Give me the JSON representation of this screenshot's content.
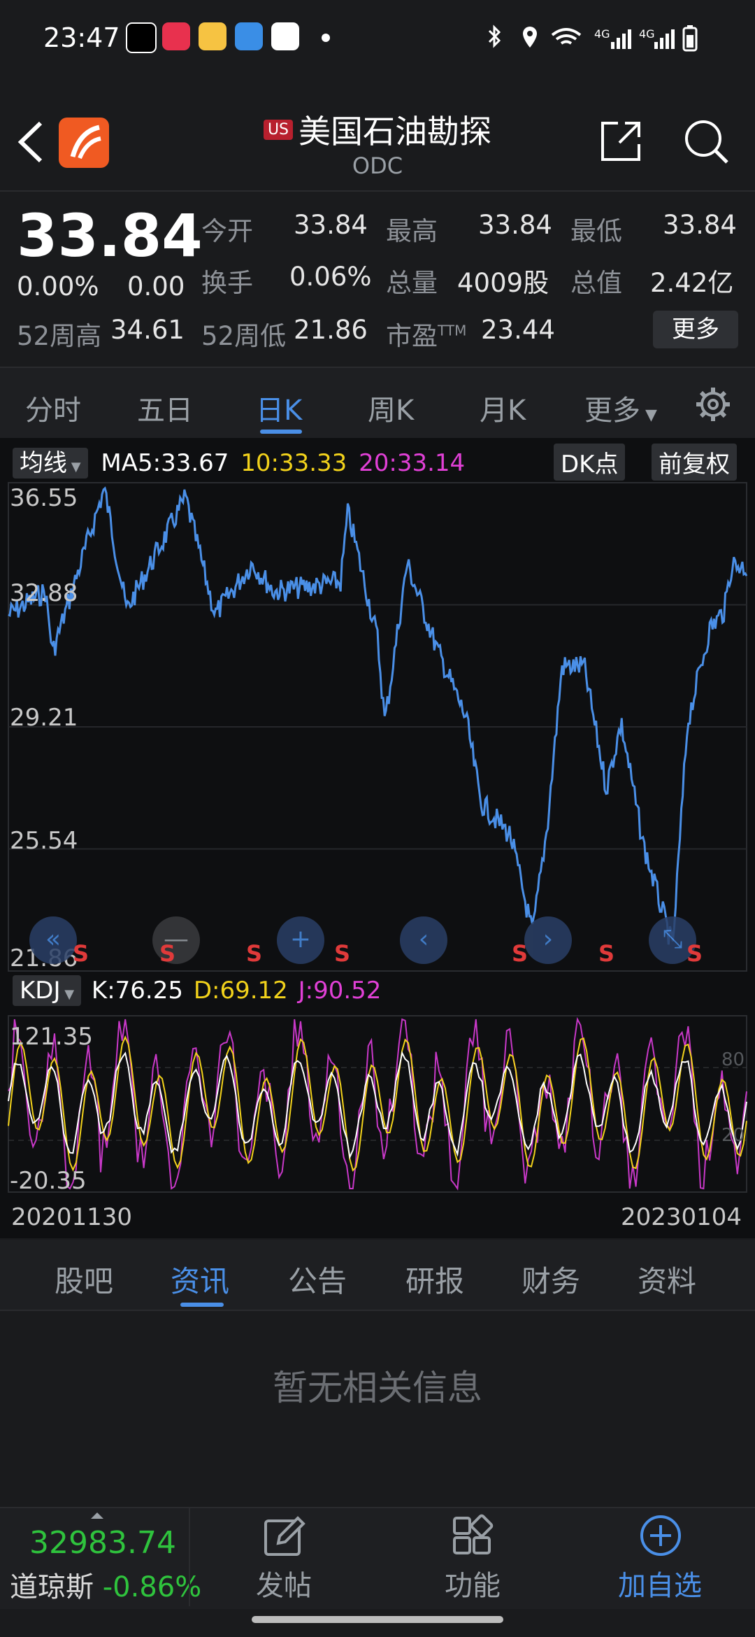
{
  "status_bar": {
    "time": "23:47",
    "network": "4G",
    "network2": "4G"
  },
  "header": {
    "market_badge": "US",
    "title": "美国石油勘探",
    "ticker": "ODC"
  },
  "quote": {
    "price": "33.84",
    "change_pct": "0.00%",
    "change": "0.00",
    "open_label": "今开",
    "open": "33.84",
    "high_label": "最高",
    "high": "33.84",
    "low_label": "最低",
    "low": "33.84",
    "turnover_label": "换手",
    "turnover": "0.06%",
    "volume_label": "总量",
    "volume": "4009股",
    "mktcap_label": "总值",
    "mktcap": "2.42亿",
    "w52h_label": "52周高",
    "w52h": "34.61",
    "w52l_label": "52周低",
    "w52l": "21.86",
    "pe_label": "市盈",
    "pe_sup": "TTM",
    "pe": "23.44",
    "more": "更多"
  },
  "chart_tabs": [
    "分时",
    "五日",
    "日K",
    "周K",
    "月K",
    "更多"
  ],
  "ma": {
    "btn": "均线",
    "ma5": "MA5:33.67",
    "ma10": "10:33.33",
    "ma20": "20:33.14",
    "dk": "DK点",
    "adj": "前复权"
  },
  "price_axis": [
    "36.55",
    "32.88",
    "29.21",
    "25.54",
    "21.86"
  ],
  "kdj": {
    "btn": "KDJ",
    "k": "K:76.25",
    "d": "D:69.12",
    "j": "J:90.52",
    "ymax": "121.35",
    "ymin": "-20.35",
    "r80": "80",
    "r20": "20"
  },
  "dates": {
    "start": "20201130",
    "end": "20230104"
  },
  "signal_label": "S",
  "info_tabs": [
    "股吧",
    "资讯",
    "公告",
    "研报",
    "财务",
    "资料"
  ],
  "empty_message": "暂无相关信息",
  "bottom": {
    "index_value": "32983.74",
    "index_name": "道琼斯",
    "index_pct": "-0.86%",
    "post": "发帖",
    "func": "功能",
    "add": "加自选"
  },
  "colors": {
    "accent": "#4a8fe7",
    "price_line": "#4a8fe7",
    "ma10": "#f2d21b",
    "ma20": "#e040d6",
    "k_line": "#ffffff",
    "d_line": "#f2d21b",
    "j_line": "#c838c8",
    "down": "#2fc33d",
    "signal": "#e03a3a"
  }
}
